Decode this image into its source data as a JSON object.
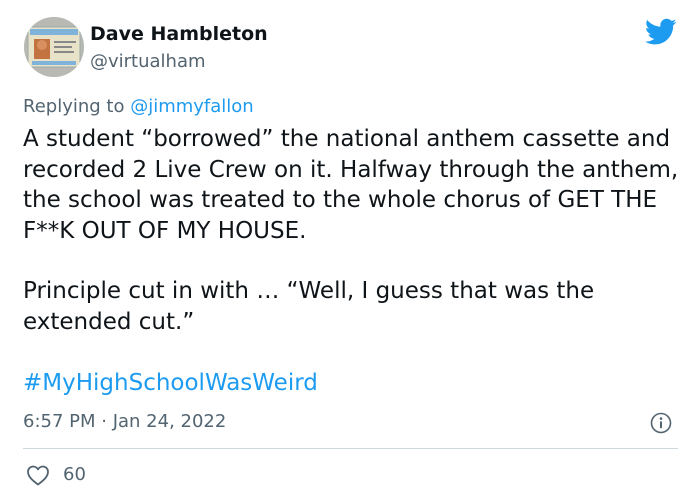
{
  "author": {
    "name": "Dave Hambleton",
    "handle": "@virtualham"
  },
  "reply": {
    "prefix": "Replying to ",
    "mention": "@jimmyfallon"
  },
  "tweet": {
    "paragraph1": "A student “borrowed” the national anthem cassette and recorded 2 Live Crew on it. Halfway through the anthem, the school was treated to the whole chorus of GET THE F**K OUT OF MY HOUSE.",
    "paragraph2": "Principle cut in with … “Well, I guess that was the extended cut.”",
    "hashtag": "#MyHighSchoolWasWeird",
    "timestamp": "6:57 PM · Jan 24, 2022"
  },
  "stats": {
    "likes": "60"
  },
  "icons": {
    "brand": "twitter-bird-icon",
    "info": "info-icon",
    "like": "heart-icon"
  },
  "colors": {
    "accent": "#1d9bf0",
    "secondary_text": "#536471",
    "primary_text": "#0f1419",
    "divider": "#cfd9de"
  }
}
